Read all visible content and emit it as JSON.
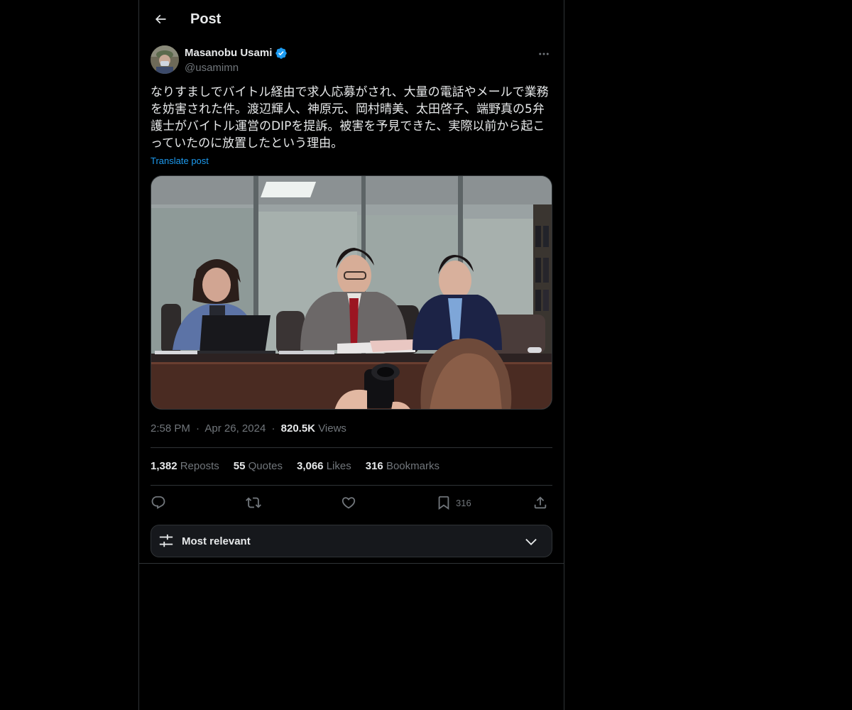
{
  "header": {
    "title": "Post",
    "back_icon": "arrow-left-icon"
  },
  "author": {
    "name": "Masanobu Usami",
    "handle": "@usamimn",
    "verified": true,
    "verified_color": "#1d9bf0"
  },
  "post": {
    "text": "なりすましでバイトル経由で求人応募がされ、大量の電話やメールで業務\nを妨害された件。渡辺輝人、神原元、岡村晴美、太田啓子、端野真の5弁\n護士がバイトル運営のDIPを提訴。被害を予見できた、実際以前から起こ\nっていたのに放置したという理由。",
    "translate_label": "Translate post"
  },
  "meta": {
    "time": "2:58 PM",
    "separator": "·",
    "date": "Apr 26, 2024",
    "views_count": "820.5K",
    "views_label": "Views"
  },
  "stats": {
    "reposts_count": "1,382",
    "reposts_label": "Reposts",
    "quotes_count": "55",
    "quotes_label": "Quotes",
    "likes_count": "3,066",
    "likes_label": "Likes",
    "bookmarks_count": "316",
    "bookmarks_label": "Bookmarks"
  },
  "actions": {
    "reply_icon": "reply-icon",
    "repost_icon": "repost-icon",
    "like_icon": "heart-icon",
    "bookmark_icon": "bookmark-icon",
    "bookmark_count": "316",
    "share_icon": "share-icon"
  },
  "sort": {
    "label": "Most relevant",
    "icon": "sliders-icon",
    "chevron": "chevron-down-icon"
  },
  "colors": {
    "background": "#000000",
    "text": "#e7e9ea",
    "muted": "#71767b",
    "accent": "#1d9bf0",
    "border": "#2f3336"
  }
}
